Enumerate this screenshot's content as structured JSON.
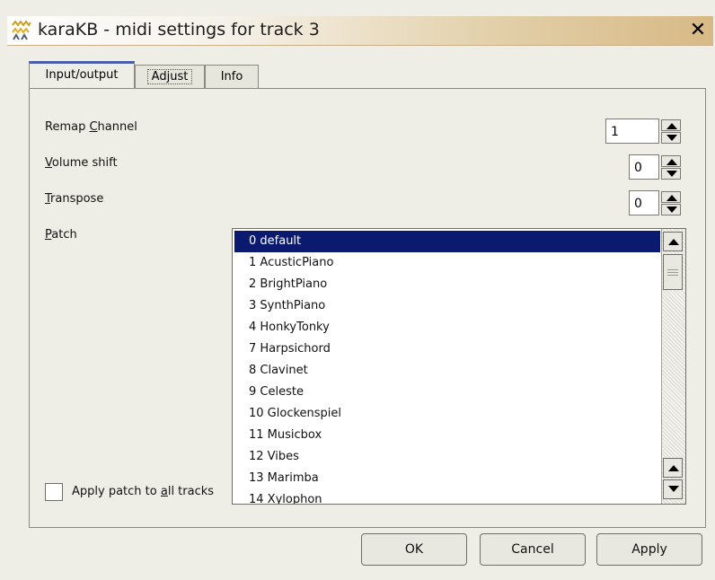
{
  "window": {
    "title": "karaKB - midi settings for track 3",
    "close_symbol": "✕",
    "app_icon": "karakb-app-icon"
  },
  "tabs": [
    {
      "label": "Input/output",
      "active": true
    },
    {
      "label": "Adjust",
      "active": false,
      "focused": true
    },
    {
      "label": "Info",
      "active": false
    }
  ],
  "fields": {
    "remap_channel": {
      "label_pre": "Remap ",
      "label_u": "C",
      "label_post": "hannel",
      "value": "1"
    },
    "volume_shift": {
      "label_pre": "",
      "label_u": "V",
      "label_post": "olume shift",
      "value": "0"
    },
    "transpose": {
      "label_pre": "",
      "label_u": "T",
      "label_post": "ranspose",
      "value": "0"
    },
    "patch": {
      "label_pre": "",
      "label_u": "P",
      "label_post": "atch"
    }
  },
  "patch_list": {
    "selected_index": 0,
    "items": [
      "0 default",
      "1 AcusticPiano",
      "2 BrightPiano",
      "3 SynthPiano",
      "4 HonkyTonky",
      "7 Harpsichord",
      "8 Clavinet",
      "9 Celeste",
      "10 Glockenspiel",
      "11 Musicbox",
      "12 Vibes",
      "13 Marimba",
      "14 Xylophon"
    ]
  },
  "apply_all": {
    "label_pre": "Apply patch to ",
    "label_u": "a",
    "label_post": "ll tracks",
    "checked": false
  },
  "buttons": {
    "ok": "OK",
    "cancel": "Cancel",
    "apply": "Apply"
  },
  "icons": {
    "spin_up": "arrow-up-icon",
    "spin_down": "arrow-down-icon",
    "scroll_up": "scroll-up-arrow-icon",
    "scroll_down": "scroll-down-arrow-icon"
  }
}
